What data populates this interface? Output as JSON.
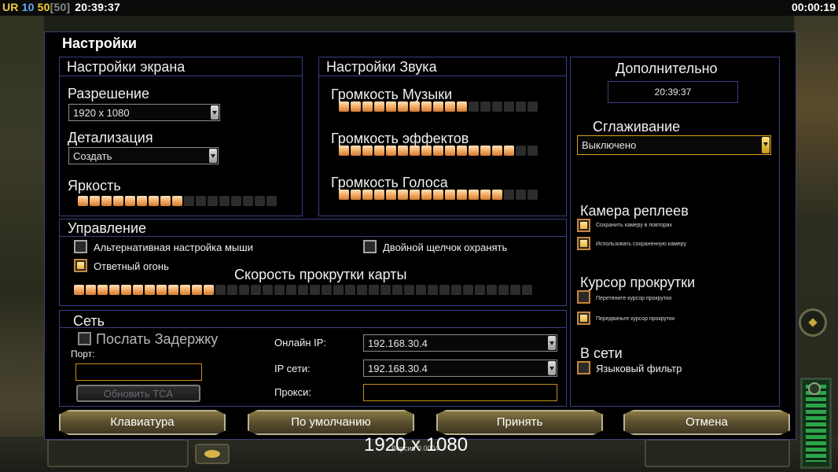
{
  "hud": {
    "ur": "UR",
    "num1": "10",
    "num2": "50",
    "num3": "[50]",
    "time": "20:39:37",
    "timer": "00:00:19"
  },
  "window": {
    "title": "Настройки"
  },
  "screen": {
    "heading": "Настройки экрана",
    "resolution_label": "Разрешение",
    "resolution_value": "1920 x 1080",
    "detail_label": "Детализация",
    "detail_value": "Создать",
    "brightness_label": "Яркость",
    "brightness": {
      "filled": 9,
      "total": 17
    }
  },
  "sound": {
    "heading": "Настройки Звука",
    "music_label": "Громкость Музыки",
    "music": {
      "filled": 11,
      "total": 17
    },
    "effects_label": "Громкость эффектов",
    "effects": {
      "filled": 15,
      "total": 17
    },
    "voice_label": "Громкость Голоса",
    "voice": {
      "filled": 14,
      "total": 17
    }
  },
  "controls": {
    "heading": "Управление",
    "alt_mouse": {
      "label": "Альтернативная настройка мыши",
      "checked": false
    },
    "double_click": {
      "label": "Двойной щелчок охранять",
      "checked": false
    },
    "return_fire": {
      "label": "Ответный огонь",
      "checked": true
    },
    "scroll_label": "Скорость прокрутки карты",
    "scroll": {
      "filled": 12,
      "total": 39
    }
  },
  "network": {
    "heading": "Сеть",
    "send_delay": "Послать Задержку",
    "port_label": "Порт:",
    "port_value": "",
    "update_button": "Обновить TCA",
    "online_ip_label": "Онлайн IP:",
    "online_ip_value": "192.168.30.4",
    "lan_ip_label": "IP сети:",
    "lan_ip_value": "192.168.30.4",
    "proxy_label": "Прокси:",
    "proxy_value": ""
  },
  "additional": {
    "heading": "Дополнительно",
    "clock": "20:39:37",
    "antialias_label": "Сглаживание",
    "antialias_value": "Выключено",
    "replay_camera_label": "Камера реплеев",
    "save_camera": "Сохранить камеру в повторах",
    "use_saved_camera": "Использовать сохраненную камеру",
    "scroll_cursor_label": "Курсор прокрутки",
    "drag_cursor": "Перетяните курсор прокрутки",
    "move_cursor": "Передвиньте курсор прокрутки",
    "online_label": "В сети",
    "language_filter": "Языковый фильтр"
  },
  "buttons": {
    "keyboard": "Клавиатура",
    "defaults": "По умолчанию",
    "accept": "Принять",
    "cancel": "Отмена"
  },
  "overlay": {
    "resolution": "1920 x 1080",
    "version": "Версия 0.0004"
  }
}
